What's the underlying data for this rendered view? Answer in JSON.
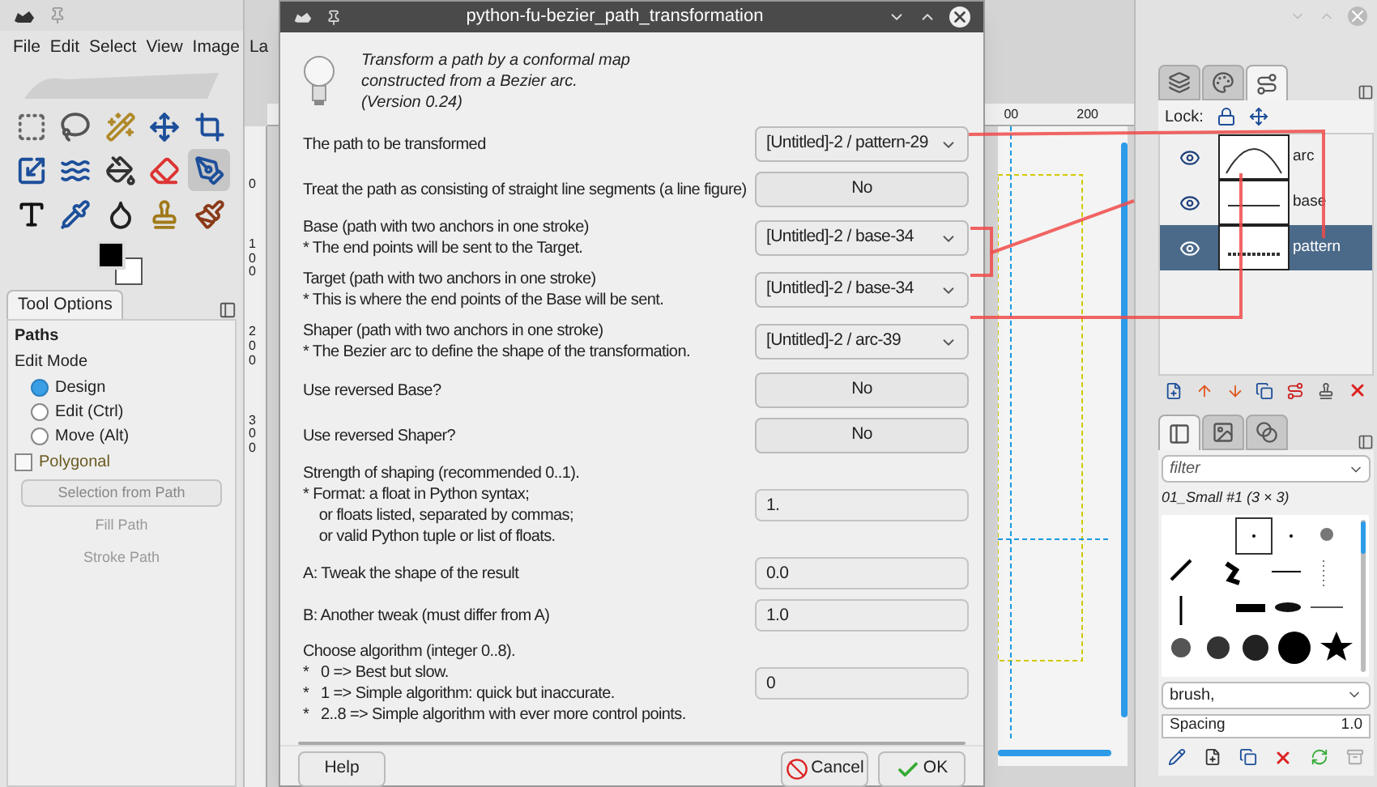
{
  "toolbox": {
    "menu": [
      "File",
      "Edit",
      "Select",
      "View",
      "Image",
      "La"
    ],
    "tools": [
      {
        "kind": "rect",
        "selected": false
      },
      {
        "kind": "lasso",
        "selected": false
      },
      {
        "kind": "wand",
        "selected": false
      },
      {
        "kind": "move",
        "selected": false
      },
      {
        "kind": "crop",
        "selected": false
      },
      {
        "kind": "scale",
        "selected": false
      },
      {
        "kind": "warp",
        "selected": false
      },
      {
        "kind": "bucket",
        "selected": false
      },
      {
        "kind": "eraser",
        "selected": false
      },
      {
        "kind": "paths",
        "selected": true
      },
      {
        "kind": "text",
        "selected": false
      },
      {
        "kind": "pipette",
        "selected": false
      },
      {
        "kind": "smudge",
        "selected": false
      },
      {
        "kind": "stamp",
        "selected": false
      },
      {
        "kind": "brush",
        "selected": false
      }
    ]
  },
  "tool_options": {
    "tab": "Tool Options",
    "title": "Paths",
    "edit_mode_label": "Edit Mode",
    "modes": [
      {
        "label": "Design",
        "selected": true
      },
      {
        "label": "Edit (Ctrl)",
        "selected": false
      },
      {
        "label": "Move (Alt)",
        "selected": false
      }
    ],
    "polygonal": {
      "label": "Polygonal",
      "checked": false
    },
    "buttons": [
      {
        "label": "Selection from Path",
        "disabled": false
      },
      {
        "label": "Fill Path",
        "disabled": true
      },
      {
        "label": "Stroke Path",
        "disabled": true
      }
    ]
  },
  "rulers": {
    "horizontal": [
      "00",
      "200"
    ],
    "vertical": [
      "0",
      "100",
      "200",
      "300"
    ]
  },
  "dialog": {
    "title": "python-fu-bezier_path_transformation",
    "description": [
      "Transform a path by a conformal map",
      "constructed from a Bezier arc.",
      "(Version 0.24)"
    ],
    "params": [
      {
        "kind": "dropdown",
        "lines": [
          "The path to be transformed"
        ],
        "value": "[Untitled]-2 / pattern-29"
      },
      {
        "kind": "toggle",
        "lines": [
          "Treat the path as consisting of straight line segments (a line figure)"
        ],
        "value": "No"
      },
      {
        "kind": "dropdown",
        "lines": [
          "Base (path with two anchors in one stroke)",
          "* The end points will be sent to the Target."
        ],
        "value": "[Untitled]-2 / base-34"
      },
      {
        "kind": "dropdown",
        "lines": [
          "Target (path with two anchors in one stroke)",
          "* This is where the end points of the Base will be sent."
        ],
        "value": "[Untitled]-2 / base-34"
      },
      {
        "kind": "dropdown",
        "lines": [
          "Shaper (path with two anchors in one stroke)",
          "* The Bezier arc to define the shape of the transformation."
        ],
        "value": "[Untitled]-2 / arc-39"
      },
      {
        "kind": "toggle",
        "lines": [
          "Use reversed Base?"
        ],
        "value": "No"
      },
      {
        "kind": "toggle",
        "lines": [
          "Use reversed Shaper?"
        ],
        "value": "No"
      },
      {
        "kind": "text",
        "lines": [
          "Strength of shaping (recommended 0..1).",
          "* Format: a float in Python syntax;",
          "    or floats listed, separated by commas;",
          "    or valid Python tuple or list of floats."
        ],
        "value": "1."
      },
      {
        "kind": "text",
        "lines": [
          "A: Tweak the shape of the result"
        ],
        "value": "0.0"
      },
      {
        "kind": "text",
        "lines": [
          "B: Another tweak (must differ from A)"
        ],
        "value": "1.0"
      },
      {
        "kind": "text",
        "lines": [
          "Choose algorithm (integer 0..8).",
          "*   0 => Best but slow.",
          "*   1 => Simple algorithm: quick but inaccurate.",
          "*   2..8 => Simple algorithm with ever more control points."
        ],
        "value": "0"
      }
    ],
    "progress": {
      "level": 0
    },
    "buttons": [
      {
        "kind": "help",
        "label": "Help"
      },
      {
        "kind": "cancel",
        "label": "Cancel"
      },
      {
        "kind": "ok",
        "label": "OK"
      }
    ]
  },
  "paths_panel": {
    "tabs": [
      {
        "kind": "layers",
        "selected": false
      },
      {
        "kind": "channels",
        "selected": false
      },
      {
        "kind": "paths",
        "selected": true
      }
    ],
    "lock_label": "Lock:",
    "paths": [
      {
        "name": "arc",
        "visible": true,
        "selected": false,
        "kind": "arc"
      },
      {
        "name": "base",
        "visible": true,
        "selected": false,
        "kind": "line"
      },
      {
        "name": "pattern",
        "visible": true,
        "selected": true,
        "kind": "pattern"
      }
    ]
  },
  "brushes_panel": {
    "tabs": [
      {
        "kind": "brushes",
        "selected": true
      },
      {
        "kind": "patterns",
        "selected": false
      },
      {
        "kind": "gradients",
        "selected": false
      }
    ],
    "filter_placeholder": "filter",
    "brush_name": "01_Small #1 (3 × 3)",
    "tag_value": "brush,",
    "spacing_label": "Spacing",
    "spacing_value": "1.0"
  }
}
